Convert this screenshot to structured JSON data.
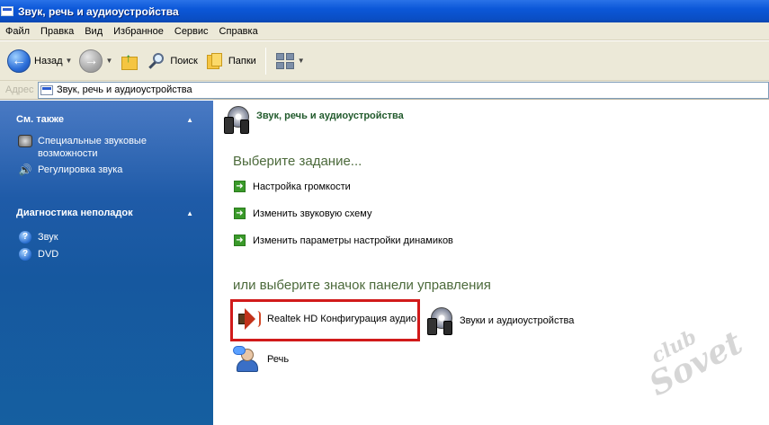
{
  "window": {
    "title": "Звук, речь и аудиоустройства"
  },
  "menubar": {
    "items": [
      "Файл",
      "Правка",
      "Вид",
      "Избранное",
      "Сервис",
      "Справка"
    ]
  },
  "toolbar": {
    "back_label": "Назад",
    "search_label": "Поиск",
    "folders_label": "Папки"
  },
  "addressbar": {
    "label": "Адрес",
    "value": "Звук, речь и аудиоустройства"
  },
  "sidebar": {
    "see_also": {
      "title": "См. также",
      "items": [
        {
          "label": "Специальные звуковые возможности",
          "icon": "sound-accessibility-icon"
        },
        {
          "label": "Регулировка звука",
          "icon": "speaker-volume-icon"
        }
      ]
    },
    "troubleshoot": {
      "title": "Диагностика неполадок",
      "items": [
        {
          "label": "Звук",
          "icon": "help-icon"
        },
        {
          "label": "DVD",
          "icon": "help-icon"
        }
      ]
    }
  },
  "main": {
    "header_title": "Звук, речь и аудиоустройства",
    "task_heading": "Выберите задание...",
    "tasks": [
      "Настройка громкости",
      "Изменить звуковую схему",
      "Изменить параметры настройки динамиков"
    ],
    "panel_heading": "или выберите значок панели управления",
    "panel_items": [
      {
        "label": "Realtek HD Конфигурация аудио",
        "icon": "realtek-speaker-icon",
        "highlighted": true
      },
      {
        "label": "Звуки и аудиоустройства",
        "icon": "sound-devices-icon"
      },
      {
        "label": "Речь",
        "icon": "speech-icon"
      }
    ]
  },
  "watermark": {
    "line1": "club",
    "line2": "Sovet"
  },
  "colors": {
    "titlebar": "#0b57d8",
    "sidebar": "#16589f",
    "highlight_border": "#d11a1a",
    "heading_green": "#4c6a3b"
  }
}
